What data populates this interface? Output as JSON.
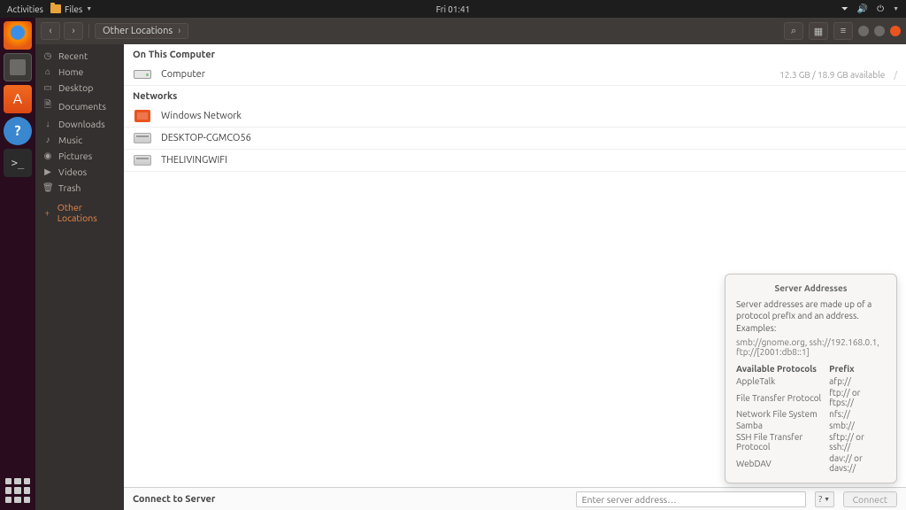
{
  "topbar": {
    "activities": "Activities",
    "files_label": "Files",
    "clock": "Fri 01:41"
  },
  "dock": {
    "firefox": "Firefox",
    "files": "Files",
    "software": "Ubuntu Software",
    "help": "Help",
    "terminal": "Terminal",
    "apps": "Show Applications"
  },
  "header": {
    "location": "Other Locations",
    "search_icon": "search",
    "view_icon": "view-grid",
    "menu_icon": "hamburger"
  },
  "sidebar": {
    "items": [
      {
        "icon": "clock",
        "label": "Recent"
      },
      {
        "icon": "home",
        "label": "Home"
      },
      {
        "icon": "desktop",
        "label": "Desktop"
      },
      {
        "icon": "docs",
        "label": "Documents"
      },
      {
        "icon": "download",
        "label": "Downloads"
      },
      {
        "icon": "music",
        "label": "Music"
      },
      {
        "icon": "camera",
        "label": "Pictures"
      },
      {
        "icon": "video",
        "label": "Videos"
      },
      {
        "icon": "trash",
        "label": "Trash"
      }
    ],
    "other_locations": "Other Locations"
  },
  "content": {
    "on_this_computer": "On This Computer",
    "computer_row": {
      "name": "Computer",
      "free": "12.3 GB / 18.9 GB available",
      "mount": "/"
    },
    "networks_label": "Networks",
    "networks": [
      {
        "name": "Windows Network",
        "kind": "win"
      },
      {
        "name": "DESKTOP-CGMCO56",
        "kind": "server"
      },
      {
        "name": "THELIVINGWIFI",
        "kind": "server"
      }
    ]
  },
  "connect": {
    "label": "Connect to Server",
    "placeholder": "Enter server address…",
    "button": "Connect"
  },
  "popover": {
    "title": "Server Addresses",
    "desc": "Server addresses are made up of a protocol prefix and an address. Examples:",
    "examples": "smb://gnome.org, ssh://192.168.0.1, ftp://[2001:db8::1]",
    "col_protocol": "Available Protocols",
    "col_prefix": "Prefix",
    "rows": [
      {
        "proto": "AppleTalk",
        "prefix": "afp://"
      },
      {
        "proto": "File Transfer Protocol",
        "prefix": "ftp:// or ftps://"
      },
      {
        "proto": "Network File System",
        "prefix": "nfs://"
      },
      {
        "proto": "Samba",
        "prefix": "smb://"
      },
      {
        "proto": "SSH File Transfer Protocol",
        "prefix": "sftp:// or ssh://"
      },
      {
        "proto": "WebDAV",
        "prefix": "dav:// or davs://"
      }
    ]
  }
}
